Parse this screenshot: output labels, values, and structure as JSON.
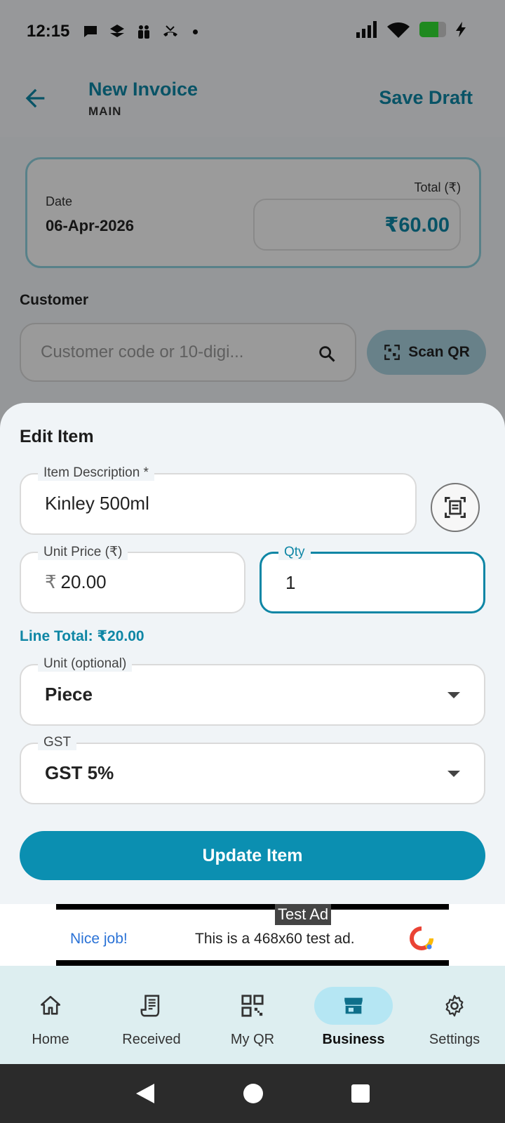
{
  "status_bar": {
    "time": "12:15",
    "battery_percent": 70
  },
  "header": {
    "title": "New Invoice",
    "subtitle": "MAIN",
    "save_draft": "Save Draft"
  },
  "summary": {
    "date_label": "Date",
    "date_value": "06-Apr-2026",
    "total_label": "Total (₹)",
    "total_value": "₹60.00"
  },
  "customer": {
    "label": "Customer",
    "placeholder": "Customer code or 10-digi...",
    "scan_qr": "Scan QR"
  },
  "sheet": {
    "title": "Edit Item",
    "item_description": {
      "label": "Item Description *",
      "value": "Kinley 500ml"
    },
    "unit_price": {
      "label": "Unit Price (₹)",
      "prefix": "₹",
      "value": "20.00"
    },
    "qty": {
      "label": "Qty",
      "value": "1"
    },
    "line_total": "Line Total: ₹20.00",
    "unit": {
      "label": "Unit (optional)",
      "value": "Piece"
    },
    "gst": {
      "label": "GST",
      "value": "GST 5%"
    },
    "update_button": "Update Item"
  },
  "ad": {
    "tag": "Test Ad",
    "nice": "Nice job!",
    "text": "This is a 468x60 test ad."
  },
  "bottom_nav": [
    {
      "label": "Home",
      "icon": "home-icon"
    },
    {
      "label": "Received",
      "icon": "receipt-icon"
    },
    {
      "label": "My QR",
      "icon": "qr-icon"
    },
    {
      "label": "Business",
      "icon": "store-icon",
      "active": true
    },
    {
      "label": "Settings",
      "icon": "gear-icon"
    }
  ],
  "colors": {
    "accent": "#0e86a5",
    "button": "#0b8fb1",
    "nav_active": "#b5e6f3"
  }
}
